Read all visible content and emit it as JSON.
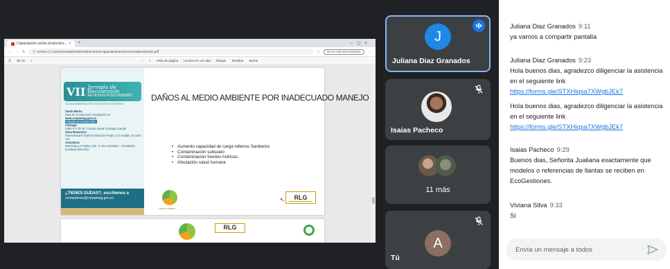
{
  "browser": {
    "tab_title": "Capacitación sector productivo...",
    "address_label": "Archivo",
    "address_path": "C:/Users/maria/OneDrive/Escritorio/Capacitaciones/Sector%20productivo.pdf",
    "not_synced": "No se está sincronizando",
    "page_indicator": "de 19",
    "tools": [
      "Vista de página",
      "Lectura en voz alta",
      "Dibujar",
      "Resaltar",
      "Borrar"
    ]
  },
  "slide": {
    "banner_number": "VII",
    "banner_title": "Jornada de Recolección",
    "banner_sub": "RESIDUOS POSCONSUMO",
    "banner_tag": "\"ALIANZA AMBIENTAL POR UNA GESTIÓN SOSTENIBLE\"",
    "city_label": "Santa Marta:",
    "city_text": "Ruta de recolección: inscripción en",
    "website": "www.corpamag.gov.co",
    "points_label": "Puntos de recolección:",
    "cienaga_label": "Ciénaga:",
    "cienaga_text": "Calle 8 # 23-20 / Centro social Ciénaga Grande",
    "zona_label": "Zona Bananera:",
    "zona_text": "Transversal 8 Total #2 Estación Prado y CI Unibán, la Gran Vía",
    "aracataca_label": "Aracataca:",
    "aracataca_text": "Hacienda La Palma, Km. 4, vía Aracataca - Fundación (costado derecho)",
    "dudas": "¿TIENES DUDAS?, escríbenos a",
    "email": "contactenos@corpamag.gov.co",
    "title": "DAÑOS AL MEDIO AMBIENTE POR INADECUADO MANEJO",
    "bullets": [
      "Aumento capacidad de carga rellenos Sanitarios",
      "Contaminación subsuelo",
      "Contaminación fuentes hídricas.",
      "Afectación salud humana"
    ],
    "logo_text": "DIGITAL GREEN",
    "rlg": "RLG",
    "page2_text": "RLG"
  },
  "participants": {
    "juliana": {
      "initial": "J",
      "name": "Juliana Diaz Granados",
      "color": "#1e88e5"
    },
    "isaias": {
      "name": "Isaias Pacheco"
    },
    "more": {
      "label": "11 más"
    },
    "you": {
      "initial": "A",
      "name": "Tú",
      "color": "#8d6e63"
    }
  },
  "chat": {
    "messages": [
      {
        "sender": "Juliana Diaz Granados",
        "time": "9:11",
        "lines": [
          "ya vamos a compartir pantalla"
        ]
      },
      {
        "sender": "Juliana Diaz Granados",
        "time": "9:23",
        "lines": [
          "Hola buenos dias, agradezco diligenciar la asistencia en el seguiente link"
        ],
        "link": "https://forms.gle/STXHiqsa7XWgbJEk7"
      },
      {
        "sender": "",
        "time": "",
        "lines": [
          "Hola buenos dias, agradezco diligenciar la asistencia en el seguiente link"
        ],
        "link": "https://forms.gle/STXHiqsa7XWgbJEk7"
      },
      {
        "sender": "Isaias Pacheco",
        "time": "9:29",
        "lines": [
          "Buenos dias, Señorita Jualiana exactamente que modelos o referencias de llantas se reciben en EcoGestiones."
        ]
      },
      {
        "sender": "Viviana Silva",
        "time": "9:33",
        "lines": [
          "Si"
        ]
      }
    ],
    "input_placeholder": "Envía un mensaje a todos"
  },
  "colors": {
    "accent": "#8ab4f8",
    "link": "#1a73e8",
    "tile_bg": "#3c4043"
  }
}
